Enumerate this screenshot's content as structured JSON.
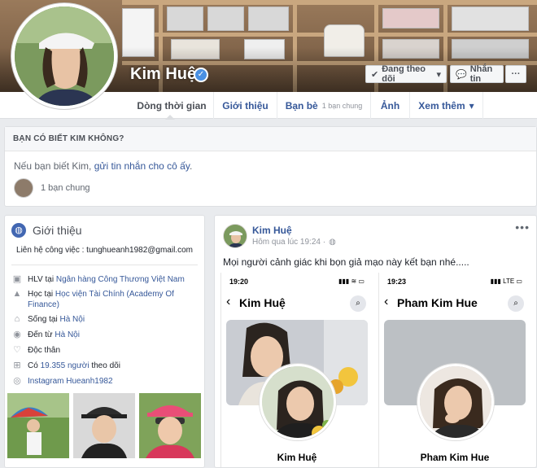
{
  "profile": {
    "name": "Kim Huệ",
    "verified_icon": "verified-check-icon",
    "actions": {
      "following_label": "Đang theo dõi",
      "message_label": "Nhắn tin",
      "more_label": "···"
    }
  },
  "nav": {
    "tabs": [
      {
        "label": "Dòng thời gian"
      },
      {
        "label": "Giới thiệu"
      },
      {
        "label": "Bạn bè",
        "sub": "1 bạn chung"
      },
      {
        "label": "Ảnh"
      },
      {
        "label": "Xem thêm"
      }
    ]
  },
  "know_card": {
    "header": "BẠN CÓ BIẾT KIM KHÔNG?",
    "text_prefix": "Nếu bạn biết Kim,",
    "link": "gửi tin nhắn cho cô ấy",
    "text_suffix": ".",
    "mutual": "1 bạn chung"
  },
  "intro": {
    "title": "Giới thiệu",
    "contact": "Liên hệ công việc : tunghueanh1982@gmail.com",
    "job_prefix": "HLV tại",
    "job_link": "Ngân hàng Công Thương Việt Nam",
    "study_prefix": "Học tại",
    "study_link": "Học viện Tài Chính (Academy Of Finance)",
    "lives_prefix": "Sống tại",
    "lives_link": "Hà Nội",
    "from_prefix": "Đến từ",
    "from_link": "Hà Nội",
    "relationship": "Độc thân",
    "followers_prefix": "Có",
    "followers_link": "19.355 người",
    "followers_suffix": "theo dõi",
    "instagram": "Instagram Hueanh1982"
  },
  "post": {
    "author": "Kim Huệ",
    "time": "Hôm qua lúc 19:24 ·",
    "text": "Mọi người cảnh giác khi bọn giả mạo này kết bạn nhé.....",
    "more": "•••",
    "phones": [
      {
        "time": "19:20",
        "signal": "▮▮▮ ≋ ▭",
        "name": "Kim Huệ"
      },
      {
        "time": "19:23",
        "signal": "▮▮▮ LTE ▭",
        "name": "Pham Kim Hue"
      }
    ]
  },
  "colors": {
    "link": "#365899",
    "bg": "#e9ebee",
    "brand": "#4267b2"
  }
}
